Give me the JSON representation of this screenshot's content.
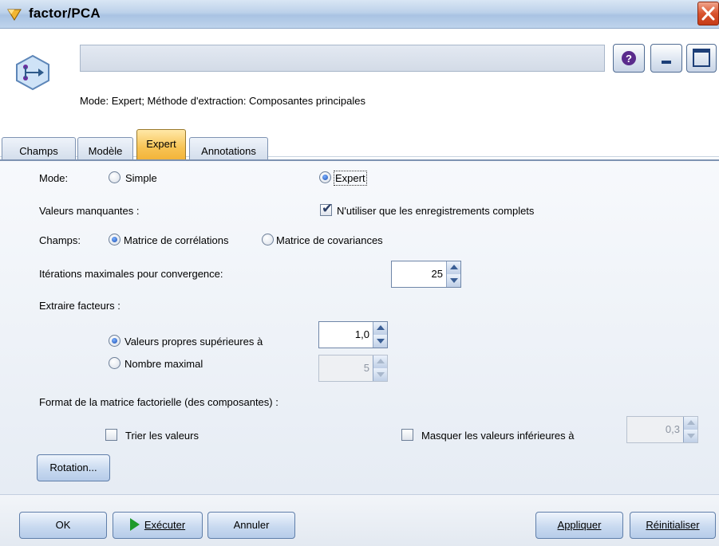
{
  "window": {
    "title": "factor/PCA",
    "name_field_value": "",
    "summary": "Mode: Expert; Méthode d'extraction: Composantes principales"
  },
  "tabs": [
    {
      "label": "Champs",
      "active": false
    },
    {
      "label": "Modèle",
      "active": false
    },
    {
      "label": "Expert",
      "active": true
    },
    {
      "label": "Annotations",
      "active": false
    }
  ],
  "form": {
    "mode_label": "Mode:",
    "mode_simple": "Simple",
    "mode_expert": "Expert",
    "mode_selected": "Expert",
    "missing_label": "Valeurs manquantes :",
    "complete_records_label": "N'utiliser que les enregistrements complets",
    "complete_records_checked": true,
    "fields_label": "Champs:",
    "corr_matrix": "Matrice de corrélations",
    "cov_matrix": "Matrice de covariances",
    "matrix_selected": "corr",
    "max_iter_label": "Itérations maximales pour convergence:",
    "max_iter_value": "25",
    "extract_label": "Extraire facteurs :",
    "eigen_label": "Valeurs propres supérieures à",
    "eigen_value": "1,0",
    "max_num_label": "Nombre maximal",
    "max_num_value": "5",
    "extract_selected": "eigen",
    "format_label": "Format de la matrice factorielle (des composantes) :",
    "sort_label": "Trier les valeurs",
    "sort_checked": false,
    "hide_label": "Masquer les valeurs inférieures à",
    "hide_checked": false,
    "hide_value": "0,3",
    "rotation_button": "Rotation..."
  },
  "buttons": {
    "ok": "OK",
    "execute": "Exécuter",
    "cancel": "Annuler",
    "apply": "Appliquer",
    "reset": "Réinitialiser"
  },
  "colors": {
    "active_tab": "#f7c455",
    "close_button": "#d9542f",
    "run_icon": "#1f9a2a"
  },
  "icons": [
    "app-icon",
    "node-icon",
    "help-icon",
    "minimize-icon",
    "maximize-icon",
    "close-icon",
    "run-icon"
  ]
}
